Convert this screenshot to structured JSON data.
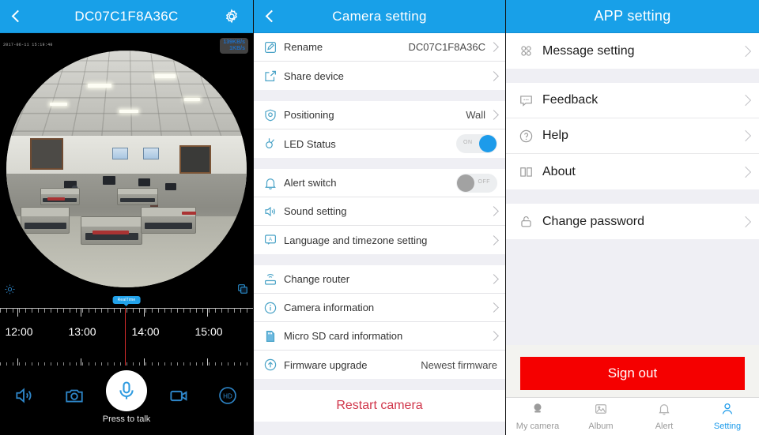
{
  "panel_live": {
    "header": {
      "title": "DC07C1F8A36C",
      "back_icon": "chevron-left-icon",
      "gear_icon": "gear-icon"
    },
    "video": {
      "timestamp": "2017-06-11 15:19:40",
      "bitrate_primary": "139KB/s",
      "bitrate_secondary": "1KB/s",
      "badge": "RealTime",
      "brightness_icon": "brightness-icon",
      "multiscreen_icon": "multi-screen-icon"
    },
    "timeline": {
      "labels": [
        "12:00",
        "13:00",
        "14:00",
        "15:00"
      ],
      "playhead_label": "RealTime"
    },
    "controls": {
      "speaker_icon": "speaker-icon",
      "snapshot_icon": "camera-icon",
      "talk_icon": "microphone-icon",
      "talk_label": "Press to talk",
      "record_icon": "video-camera-icon",
      "quality_icon": "hd-icon",
      "quality_label": "HD"
    }
  },
  "panel_camera_setting": {
    "header": {
      "title": "Camera setting",
      "back_icon": "chevron-left-icon"
    },
    "groups": [
      {
        "rows": [
          {
            "icon": "pencil-edit-icon",
            "label": "Rename",
            "value": "DC07C1F8A36C",
            "chevron": true
          },
          {
            "icon": "share-icon",
            "label": "Share device",
            "value": "",
            "chevron": true
          }
        ]
      },
      {
        "rows": [
          {
            "icon": "shield-position-icon",
            "label": "Positioning",
            "value": "Wall",
            "chevron": true
          },
          {
            "icon": "led-bulb-icon",
            "label": "LED Status",
            "toggle": "on",
            "toggle_text": "ON"
          }
        ]
      },
      {
        "rows": [
          {
            "icon": "bell-icon",
            "label": "Alert switch",
            "toggle": "off",
            "toggle_text": "OFF"
          },
          {
            "icon": "sound-icon",
            "label": "Sound setting",
            "value": "",
            "chevron": true
          },
          {
            "icon": "language-icon",
            "label": "Language and timezone setting",
            "value": "",
            "chevron": true
          }
        ]
      },
      {
        "rows": [
          {
            "icon": "router-icon",
            "label": "Change router",
            "value": "",
            "chevron": true
          },
          {
            "icon": "info-icon",
            "label": "Camera information",
            "value": "",
            "chevron": true
          },
          {
            "icon": "sd-card-icon",
            "label": "Micro SD card information",
            "value": "",
            "chevron": true
          },
          {
            "icon": "upload-arrow-icon",
            "label": "Firmware upgrade",
            "value": "Newest firmware",
            "chevron": false
          }
        ]
      }
    ],
    "restart_label": "Restart camera"
  },
  "panel_app_setting": {
    "header": {
      "title": "APP setting"
    },
    "groups": [
      {
        "rows": [
          {
            "icon": "grid-apps-icon",
            "label": "Message setting"
          }
        ]
      },
      {
        "rows": [
          {
            "icon": "feedback-bubble-icon",
            "label": "Feedback"
          },
          {
            "icon": "question-help-icon",
            "label": "Help"
          },
          {
            "icon": "book-about-icon",
            "label": "About"
          }
        ]
      },
      {
        "rows": [
          {
            "icon": "lock-icon",
            "label": "Change password"
          }
        ]
      }
    ],
    "sign_out_label": "Sign out",
    "tabs": [
      {
        "icon": "camera-tab-icon",
        "label": "My camera",
        "active": false
      },
      {
        "icon": "album-tab-icon",
        "label": "Album",
        "active": false
      },
      {
        "icon": "alert-bell-tab-icon",
        "label": "Alert",
        "active": false
      },
      {
        "icon": "person-tab-icon",
        "label": "Setting",
        "active": true
      }
    ]
  },
  "colors": {
    "header_blue": "#18A0E8",
    "accent_blue": "#1d9bea",
    "danger_red": "#F50000",
    "restart_red": "#d0354a",
    "icon_teal": "#4aa3c7"
  }
}
